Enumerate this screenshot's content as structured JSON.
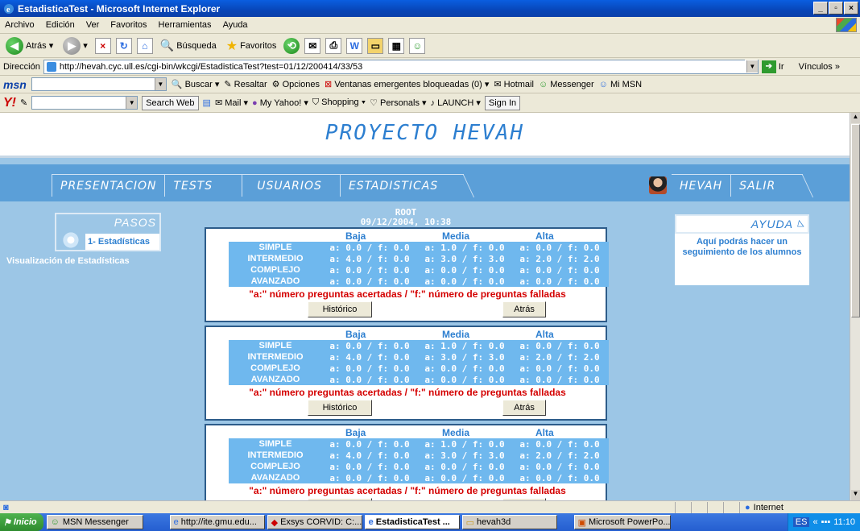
{
  "window": {
    "title": "EstadisticaTest - Microsoft Internet Explorer"
  },
  "menu": [
    "Archivo",
    "Edición",
    "Ver",
    "Favoritos",
    "Herramientas",
    "Ayuda"
  ],
  "toolbar": {
    "back": "Atrás",
    "search": "Búsqueda",
    "favorites": "Favoritos"
  },
  "address": {
    "label": "Dirección",
    "url": "http://hevah.cyc.ull.es/cgi-bin/wkcgi/EstadisticaTest?test=01/12/200414/33/53",
    "go": "Ir",
    "links": "Vínculos »"
  },
  "msnbar": {
    "logo": "msn",
    "buscar": "Buscar",
    "resaltar": "Resaltar",
    "opciones": "Opciones",
    "popups": "Ventanas emergentes bloqueadas (0)",
    "hotmail": "Hotmail",
    "messenger": "Messenger",
    "mimsn": "Mi MSN"
  },
  "yahoobar": {
    "logo": "Y!",
    "search": "Search Web",
    "mail": "Mail",
    "myyahoo": "My Yahoo!",
    "shopping": "Shopping",
    "personals": "Personals",
    "launch": "LAUNCH",
    "signin": "Sign In"
  },
  "page": {
    "title": "PROYECTO HEVAH",
    "nav": [
      "PRESENTACION",
      "TESTS",
      "USUARIOS",
      "ESTADISTICAS"
    ],
    "user_nav": [
      "HEVAH",
      "SALIR"
    ],
    "pasos": {
      "title": "PASOS",
      "step": "1- Estadísticas",
      "desc": "Visualización de Estadísticas"
    },
    "ayuda": {
      "title": "AYUDA",
      "text": "Aquí podrás hacer un seguimiento de los alumnos"
    },
    "root": "ROOT",
    "datetime": "09/12/2004, 10:38",
    "columns": [
      "Baja",
      "Media",
      "Alta"
    ],
    "legend": "\"a:\" número preguntas acertadas / \"f:\" número de preguntas falladas",
    "btn_historico": "Histórico",
    "btn_atras": "Atrás",
    "panels": [
      {
        "rows": [
          {
            "label": "SIMPLE",
            "baja": "a: 0.0 / f: 0.0",
            "media": "a: 1.0 / f: 0.0",
            "alta": "a: 0.0 / f: 0.0"
          },
          {
            "label": "INTERMEDIO",
            "baja": "a: 4.0 / f: 0.0",
            "media": "a: 3.0 / f: 3.0",
            "alta": "a: 2.0 / f: 2.0"
          },
          {
            "label": "COMPLEJO",
            "baja": "a: 0.0 / f: 0.0",
            "media": "a: 0.0 / f: 0.0",
            "alta": "a: 0.0 / f: 0.0"
          },
          {
            "label": "AVANZADO",
            "baja": "a: 0.0 / f: 0.0",
            "media": "a: 0.0 / f: 0.0",
            "alta": "a: 0.0 / f: 0.0"
          }
        ]
      },
      {
        "rows": [
          {
            "label": "SIMPLE",
            "baja": "a: 0.0 / f: 0.0",
            "media": "a: 1.0 / f: 0.0",
            "alta": "a: 0.0 / f: 0.0"
          },
          {
            "label": "INTERMEDIO",
            "baja": "a: 4.0 / f: 0.0",
            "media": "a: 3.0 / f: 3.0",
            "alta": "a: 2.0 / f: 2.0"
          },
          {
            "label": "COMPLEJO",
            "baja": "a: 0.0 / f: 0.0",
            "media": "a: 0.0 / f: 0.0",
            "alta": "a: 0.0 / f: 0.0"
          },
          {
            "label": "AVANZADO",
            "baja": "a: 0.0 / f: 0.0",
            "media": "a: 0.0 / f: 0.0",
            "alta": "a: 0.0 / f: 0.0"
          }
        ]
      },
      {
        "rows": [
          {
            "label": "SIMPLE",
            "baja": "a: 0.0 / f: 0.0",
            "media": "a: 1.0 / f: 0.0",
            "alta": "a: 0.0 / f: 0.0"
          },
          {
            "label": "INTERMEDIO",
            "baja": "a: 4.0 / f: 0.0",
            "media": "a: 3.0 / f: 3.0",
            "alta": "a: 2.0 / f: 2.0"
          },
          {
            "label": "COMPLEJO",
            "baja": "a: 0.0 / f: 0.0",
            "media": "a: 0.0 / f: 0.0",
            "alta": "a: 0.0 / f: 0.0"
          },
          {
            "label": "AVANZADO",
            "baja": "a: 0.0 / f: 0.0",
            "media": "a: 0.0 / f: 0.0",
            "alta": "a: 0.0 / f: 0.0"
          }
        ]
      }
    ]
  },
  "status": {
    "zone": "Internet"
  },
  "taskbar": {
    "start": "Inicio",
    "tasks": [
      "MSN Messenger",
      "http://ite.gmu.edu...",
      "Exsys CORVID: C:...",
      "EstadisticaTest ...",
      "hevah3d",
      "Microsoft PowerPo..."
    ],
    "lang": "ES",
    "clock": "11:10"
  },
  "colors": {
    "accent": "#2d7fd0",
    "nav": "#5b9fd8",
    "page_bg": "#9cc6e6",
    "legend": "#d40000",
    "cell": "#6fb8ee"
  }
}
